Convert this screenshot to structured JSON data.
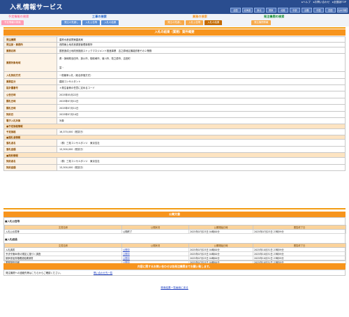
{
  "header": {
    "title": "入札情報サービス",
    "util": [
      "ヘルプ",
      "お問い合わせ",
      "全国版TOP"
    ],
    "regions": [
      "全国",
      "北海道",
      "東北",
      "関東",
      "北陸",
      "中部",
      "近畿",
      "中国",
      "四国",
      "九州沖縄"
    ]
  },
  "nav": {
    "groups": [
      {
        "label": "予定情報の検索",
        "color": "#ff7fa0",
        "tabs": [
          {
            "label": "予定情報の検索"
          }
        ]
      },
      {
        "label": "工事の検索",
        "color": "#1a5fc9",
        "tabs": [
          {
            "label": "発注の見通し"
          },
          {
            "label": "入札公告等"
          },
          {
            "label": "入札の結果"
          }
        ]
      },
      {
        "label": "業務の検索",
        "color": "#f7941d",
        "tabs": [
          {
            "label": "発注の見通し"
          },
          {
            "label": "入札公告等"
          },
          {
            "label": "入札の結果"
          }
        ]
      },
      {
        "label": "発注機関の検索",
        "color": "#0a8a2a",
        "tabs": [
          {
            "label": "発注機関情報"
          }
        ]
      }
    ]
  },
  "page": {
    "heading": "入札の結果（業務）案件概要"
  },
  "details": [
    {
      "k": "発注機関",
      "v": "農林水産省関東農政局"
    },
    {
      "k": "発注部・事務所",
      "v": "西関東土地改良調査管理事務所"
    },
    {
      "k": "業務名称",
      "v": "国営造成土地改良施設ストックマネジメント推進事業　吉之原地区機能診断その２業務"
    },
    {
      "k": "業務対象地域",
      "v": "県・静岡県島田市、掛川市、御前崎市、菊川市、牧之原市、吉田町\n\n\n富・"
    },
    {
      "k": "入札契約方式",
      "v": "一般競争入札（総合評価方式）"
    },
    {
      "k": "業務区分",
      "v": "建設コンサルタント"
    },
    {
      "k": "設計書番号",
      "v": "＊発注者側の任意に定めるコード"
    },
    {
      "k": "公告日時",
      "v": "2025年05月22日"
    },
    {
      "k": "開札日時",
      "v": "2025年07月11日"
    },
    {
      "k": "開札日時",
      "v": "2025年07月11日"
    },
    {
      "k": "契約日",
      "v": "2025年07月14日"
    },
    {
      "k": "電子入札対象",
      "v": "対象"
    },
    {
      "group": "■予定価格情報"
    },
    {
      "k": "予定価格",
      "v": "16,370,000（税抜き）"
    },
    {
      "group": "■落札者情報"
    },
    {
      "k": "落札者名",
      "v": "（株）三祐コンサルタンツ　東京支社"
    },
    {
      "k": "落札金額",
      "v": "13,300,000（税抜き）"
    },
    {
      "group": "■契約情報"
    },
    {
      "k": "契約者名",
      "v": "（株）三祐コンサルタンツ　東京支社"
    },
    {
      "k": "契約金額",
      "v": "13,300,000（税抜き）"
    }
  ],
  "public_docs": {
    "heading": "公開文書",
    "columns": [
      "文書名称",
      "公開状況",
      "公開開始日時",
      "閲覧終了日"
    ],
    "koukoku_title": "■入札公告等",
    "koukoku_rows": [
      {
        "name": "入札公示書等",
        "status": "公開終了",
        "start": "2025年07月23日 04時00分",
        "end": "2025年07月23日 23時59分"
      }
    ],
    "kekka_title": "■入札経過",
    "kekka_rows": [
      {
        "name": "入札調書",
        "status": "公開中",
        "start": "2025年07月23日 04時00分",
        "end": "2025年10月31日 23時59分"
      },
      {
        "name": "予決令第86条の規定に基づく調査",
        "status": "公開中",
        "start": "2025年07月23日 04時00分",
        "end": "2025年10月31日 23時59分"
      },
      {
        "name": "競争参加資格確認結果調書",
        "status": "公開中",
        "start": "2025年07月23日 04時00分",
        "end": "2025年10月31日 23時59分"
      },
      {
        "name": "業務契約情報",
        "status": "公開中",
        "start": "2025年07月23日 04時00分",
        "end": "2025年10月31日 23時59分"
      }
    ]
  },
  "contact": {
    "heading": "内容に関するお問い合わせは各発注機関までお願い致します。",
    "text": "発注機関への連絡先等はこちらからご確認ください。",
    "link": "問い合わせ先一覧"
  },
  "back_link": "検索結果一覧画面に戻る"
}
